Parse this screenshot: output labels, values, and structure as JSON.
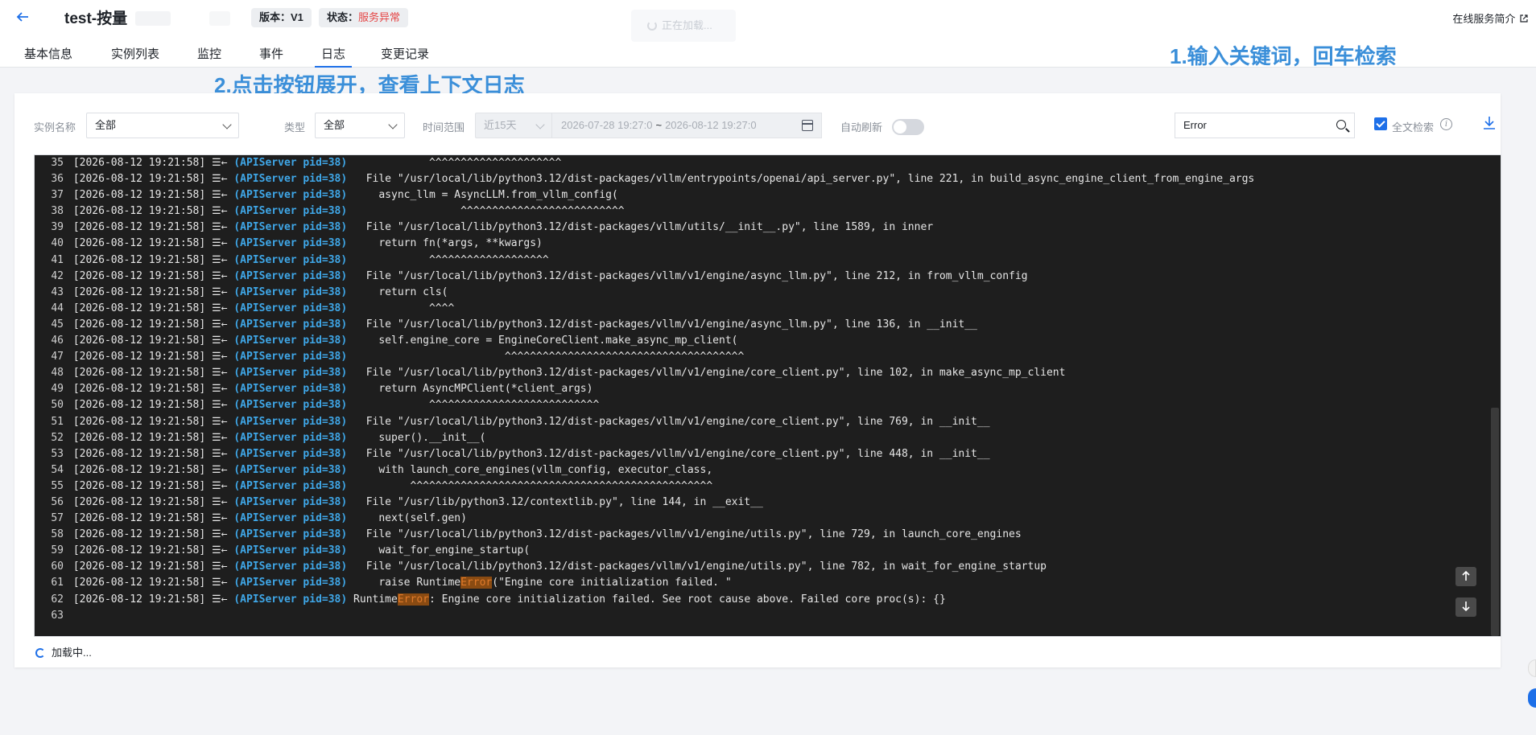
{
  "header": {
    "title": "test-按量",
    "version_label": "版本：",
    "version_value": "V1",
    "status_label": "状态：",
    "status_value": "服务异常",
    "loading_toast": "正在加载...",
    "intro_link": "在线服务简介",
    "tabs": [
      {
        "label": "基本信息",
        "active": false
      },
      {
        "label": "实例列表",
        "active": false
      },
      {
        "label": "监控",
        "active": false
      },
      {
        "label": "事件",
        "active": false
      },
      {
        "label": "日志",
        "active": true
      },
      {
        "label": "变更记录",
        "active": false
      }
    ]
  },
  "annotations": {
    "step1": "1.输入关键词，回车检索",
    "step2": "2.点击按钮展开，查看上下文日志"
  },
  "filters": {
    "instance_label": "实例名称",
    "instance_value": "全部",
    "type_label": "类型",
    "type_value": "全部",
    "time_label": "时间范围",
    "time_preset": "近15天",
    "time_start": "2026-07-28 19:27:0",
    "time_sep": "~",
    "time_end": "2026-08-12 19:27:0",
    "auto_refresh_label": "自动刷新",
    "auto_refresh_on": false,
    "search_value": "Error",
    "fulltext_label": "全文检索",
    "fulltext_checked": true
  },
  "logs": {
    "timestamp": "[2026-08-12 19:21:58]",
    "expand_glyph": "☰←",
    "source": "(APIServer pid=38)",
    "highlight_term": "Error",
    "lines": [
      {
        "n": "35",
        "text": "            ^^^^^^^^^^^^^^^^^^^^^"
      },
      {
        "n": "36",
        "text": "  File \"/usr/local/lib/python3.12/dist-packages/vllm/entrypoints/openai/api_server.py\", line 221, in build_async_engine_client_from_engine_args"
      },
      {
        "n": "37",
        "text": "    async_llm = AsyncLLM.from_vllm_config("
      },
      {
        "n": "38",
        "text": "                 ^^^^^^^^^^^^^^^^^^^^^^^^^^"
      },
      {
        "n": "39",
        "text": "  File \"/usr/local/lib/python3.12/dist-packages/vllm/utils/__init__.py\", line 1589, in inner"
      },
      {
        "n": "40",
        "text": "    return fn(*args, **kwargs)"
      },
      {
        "n": "41",
        "text": "            ^^^^^^^^^^^^^^^^^^^"
      },
      {
        "n": "42",
        "text": "  File \"/usr/local/lib/python3.12/dist-packages/vllm/v1/engine/async_llm.py\", line 212, in from_vllm_config"
      },
      {
        "n": "43",
        "text": "    return cls("
      },
      {
        "n": "44",
        "text": "            ^^^^"
      },
      {
        "n": "45",
        "text": "  File \"/usr/local/lib/python3.12/dist-packages/vllm/v1/engine/async_llm.py\", line 136, in __init__"
      },
      {
        "n": "46",
        "text": "    self.engine_core = EngineCoreClient.make_async_mp_client("
      },
      {
        "n": "47",
        "text": "                        ^^^^^^^^^^^^^^^^^^^^^^^^^^^^^^^^^^^^^^"
      },
      {
        "n": "48",
        "text": "  File \"/usr/local/lib/python3.12/dist-packages/vllm/v1/engine/core_client.py\", line 102, in make_async_mp_client"
      },
      {
        "n": "49",
        "text": "    return AsyncMPClient(*client_args)"
      },
      {
        "n": "50",
        "text": "            ^^^^^^^^^^^^^^^^^^^^^^^^^^^"
      },
      {
        "n": "51",
        "text": "  File \"/usr/local/lib/python3.12/dist-packages/vllm/v1/engine/core_client.py\", line 769, in __init__"
      },
      {
        "n": "52",
        "text": "    super().__init__("
      },
      {
        "n": "53",
        "text": "  File \"/usr/local/lib/python3.12/dist-packages/vllm/v1/engine/core_client.py\", line 448, in __init__"
      },
      {
        "n": "54",
        "text": "    with launch_core_engines(vllm_config, executor_class,"
      },
      {
        "n": "55",
        "text": "         ^^^^^^^^^^^^^^^^^^^^^^^^^^^^^^^^^^^^^^^^^^^^^^^^"
      },
      {
        "n": "56",
        "text": "  File \"/usr/lib/python3.12/contextlib.py\", line 144, in __exit__"
      },
      {
        "n": "57",
        "text": "    next(self.gen)"
      },
      {
        "n": "58",
        "text": "  File \"/usr/local/lib/python3.12/dist-packages/vllm/v1/engine/utils.py\", line 729, in launch_core_engines"
      },
      {
        "n": "59",
        "text": "    wait_for_engine_startup("
      },
      {
        "n": "60",
        "text": "  File \"/usr/local/lib/python3.12/dist-packages/vllm/v1/engine/utils.py\", line 782, in wait_for_engine_startup"
      },
      {
        "n": "61",
        "text": "    raise RuntimeError(\"Engine core initialization failed. \""
      },
      {
        "n": "62",
        "text": "RuntimeError: Engine core initialization failed. See root cause above. Failed core proc(s): {}"
      },
      {
        "n": "63",
        "text": ""
      }
    ]
  },
  "loading_more": "加载中...",
  "colors": {
    "accent": "#1d6fe8",
    "status_error": "#e54545",
    "annotation": "#3b8fd9",
    "log_bg": "#1e1e1e",
    "log_source": "#3fa7e8",
    "log_highlight": "#e07a2a"
  },
  "icons": {
    "back": "arrow-left-icon",
    "external": "external-link-icon",
    "calendar": "calendar-icon",
    "search": "search-icon",
    "info": "info-icon",
    "download": "download-icon",
    "expand": "expand-context-icon",
    "scroll_top": "arrow-up-icon",
    "scroll_bottom": "arrow-down-icon"
  }
}
